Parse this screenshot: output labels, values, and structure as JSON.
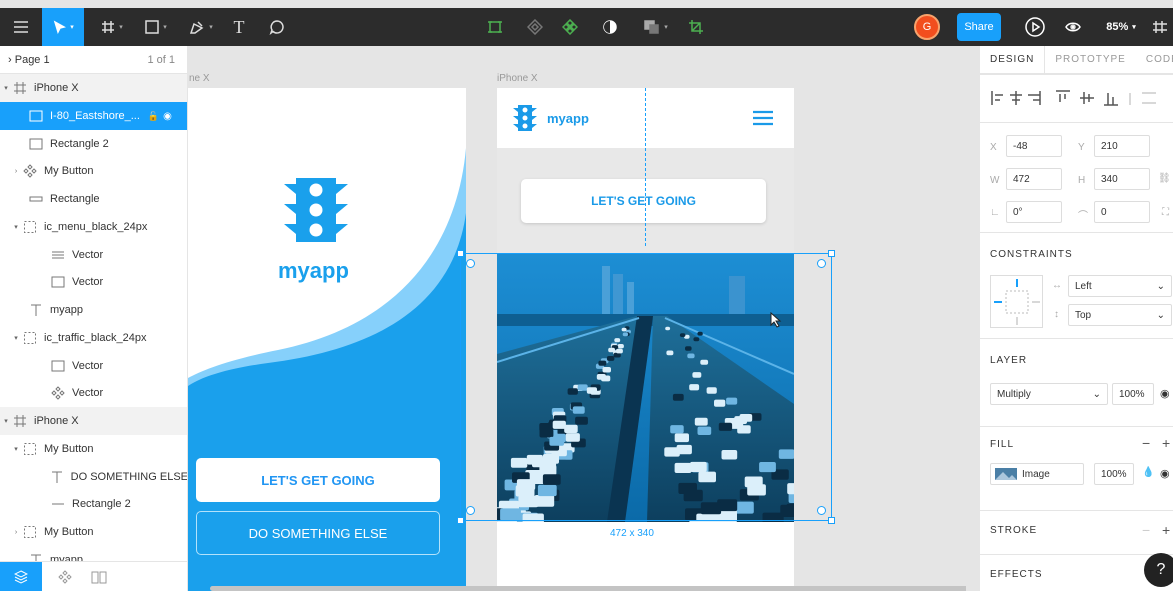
{
  "toolbar": {
    "share_label": "Share",
    "avatar_initial": "G",
    "zoom_label": "85%",
    "tools": [
      "menu-icon",
      "move-tool",
      "frame-tool",
      "shape-tool",
      "pen-tool",
      "text-tool",
      "comment-tool"
    ]
  },
  "layers": {
    "page_name": "Page 1",
    "page_count": "1 of 1",
    "items": [
      {
        "label": "iPhone X",
        "type": "frame"
      },
      {
        "label": "I-80_Eastshore_...",
        "type": "image",
        "selected": true
      },
      {
        "label": "Rectangle 2",
        "type": "rect"
      },
      {
        "label": "My Button",
        "type": "component"
      },
      {
        "label": "Rectangle",
        "type": "rect"
      },
      {
        "label": "ic_menu_black_24px",
        "type": "group"
      },
      {
        "label": "Vector",
        "type": "vector"
      },
      {
        "label": "Vector",
        "type": "vector"
      },
      {
        "label": "myapp",
        "type": "text"
      },
      {
        "label": "ic_traffic_black_24px",
        "type": "group"
      },
      {
        "label": "Vector",
        "type": "vector"
      },
      {
        "label": "Vector",
        "type": "component"
      },
      {
        "label": "iPhone X",
        "type": "frame"
      },
      {
        "label": "My Button",
        "type": "group"
      },
      {
        "label": "DO SOMETHING ELSE",
        "type": "text"
      },
      {
        "label": "Rectangle 2",
        "type": "rect"
      },
      {
        "label": "My Button",
        "type": "group"
      },
      {
        "label": "myapp",
        "type": "text"
      }
    ]
  },
  "canvas": {
    "frame1_label": "iPhone X",
    "frame1_label_visible": "ne X",
    "frame2_label": "iPhone X",
    "frame1": {
      "logo_text": "myapp",
      "primary_button": "LET'S GET GOING",
      "secondary_button": "DO SOMETHING ELSE"
    },
    "frame2": {
      "logo_text": "myapp",
      "button": "LET'S GET GOING"
    },
    "selection_dims": "472 x 340"
  },
  "design": {
    "tabs": [
      "DESIGN",
      "PROTOTYPE",
      "CODE"
    ],
    "x": "-48",
    "y": "210",
    "w": "472",
    "h": "340",
    "rotation": "0°",
    "radius": "0",
    "constraints_title": "CONSTRAINTS",
    "constraint_h": "Left",
    "constraint_v": "Top",
    "layer_title": "LAYER",
    "blend": "Multiply",
    "opacity": "100%",
    "fill_title": "FILL",
    "fill_type": "Image",
    "fill_opacity": "100%",
    "stroke_title": "STROKE",
    "effects_title": "EFFECTS",
    "lbl_x": "X",
    "lbl_y": "Y",
    "lbl_w": "W",
    "lbl_h": "H"
  },
  "help": "?",
  "colors": {
    "accent": "#18a0fb",
    "brand": "#1aa0ec",
    "toolbar": "#2c2c2c",
    "avatar": "#f24e1e"
  }
}
